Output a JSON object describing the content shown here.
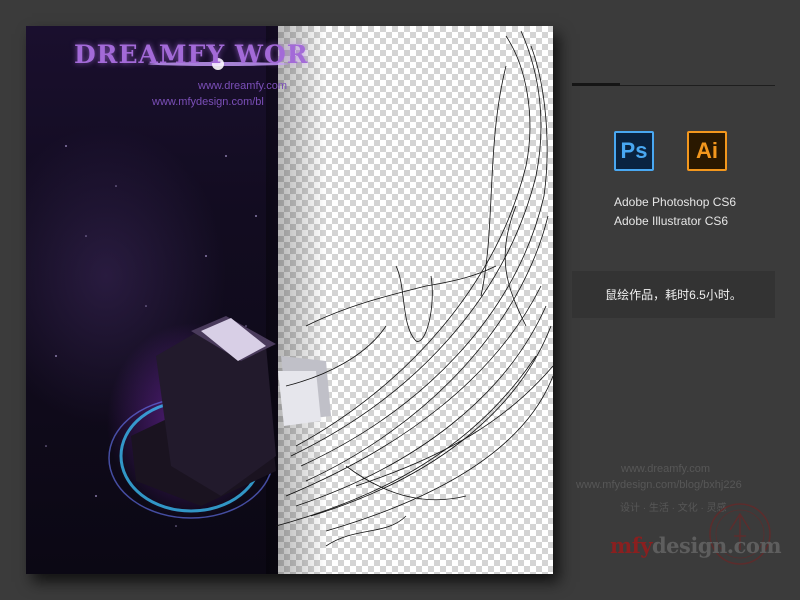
{
  "artwork": {
    "title": "DREAMFY WOR",
    "url1": "www.dreamfy.com",
    "url2": "www.mfydesign.com/bl"
  },
  "software": [
    {
      "icon": "Ps",
      "name": "Adobe Photoshop CS6",
      "color": "#49a8f2"
    },
    {
      "icon": "Ai",
      "name": "Adobe Illustrator CS6",
      "color": "#f3971d"
    }
  ],
  "notice": "鼠绘作品，耗时6.5小时。",
  "watermark": {
    "url1": "www.dreamfy.com",
    "url2": "www.mfydesign.com/blog/bxhj226",
    "tagline": "设计 · 生活 · 文化 · 灵感",
    "logo_prefix": "mfy",
    "logo_suffix": "design.com"
  },
  "colors": {
    "background": "#3b3b3b",
    "accent_purple": "#a36ad8"
  }
}
